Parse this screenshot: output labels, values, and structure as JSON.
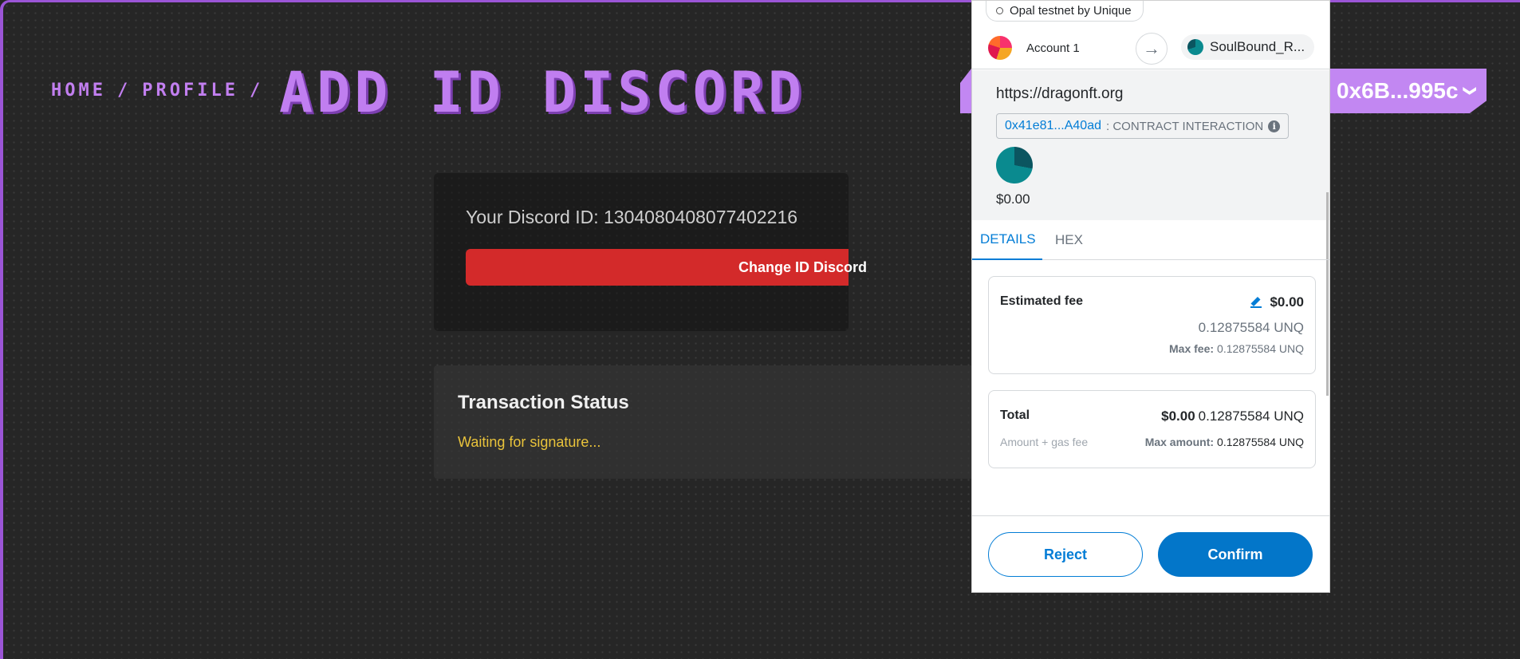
{
  "header": {
    "breadcrumb": [
      "HOME",
      "PROFILE"
    ],
    "separator": "/",
    "title": "ADD ID DISCORD",
    "wallet_label": "0x6B...995c",
    "wallet_chevron": "❯"
  },
  "discord_card": {
    "id_text": "Your Discord ID: 1304080408077402216",
    "change_button": "Change ID Discord"
  },
  "transaction": {
    "title": "Transaction Status",
    "status": "Waiting for signature..."
  },
  "metamask": {
    "network": "Opal testnet by Unique",
    "from_account": "Account 1",
    "to_account": "SoulBound_R...",
    "origin": "https://dragonft.org",
    "contract_address": "0x41e81...A40ad",
    "contract_label": ": CONTRACT INTERACTION",
    "info_icon": "i",
    "token_value": "$0.00",
    "tabs": [
      "DETAILS",
      "HEX"
    ],
    "estimated_fee": {
      "label": "Estimated fee",
      "usd": "$0.00",
      "native": "0.12875584 UNQ",
      "max_label": "Max fee:",
      "max_value": "0.12875584 UNQ"
    },
    "total": {
      "label": "Total",
      "sub": "Amount + gas fee",
      "usd": "$0.00",
      "native": "0.12875584 UNQ",
      "max_label": "Max amount:",
      "max_value": "0.12875584 UNQ"
    },
    "buttons": {
      "reject": "Reject",
      "confirm": "Confirm"
    }
  },
  "colors": {
    "accent_purple": "#c07ef0",
    "danger_red": "#d32a2a",
    "status_yellow": "#e9c33b",
    "metamask_blue": "#037dd6"
  }
}
